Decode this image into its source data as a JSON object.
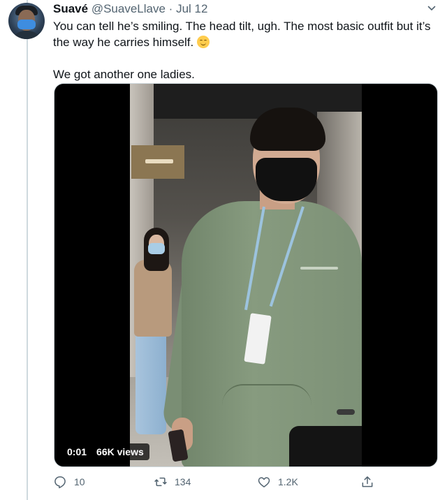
{
  "tweet": {
    "author_name": "Suavé",
    "author_handle": "@SuaveLlave",
    "separator": "·",
    "date": "Jul 12",
    "text_line_1": "You can tell he’s smiling. The head tilt, ugh. The most basic outfit but it’s the way he carries himself.",
    "emoji": "relieved-face-emoji",
    "text_line_2": "We got another one ladies.",
    "avatar": "avatar-masked-man"
  },
  "video": {
    "timestamp": "0:01",
    "views": "66K views"
  },
  "actions": {
    "reply_icon": "reply-icon",
    "reply_count": "10",
    "retweet_icon": "retweet-icon",
    "retweet_count": "134",
    "like_icon": "heart-icon",
    "like_count": "1.2K",
    "share_icon": "share-icon"
  },
  "colors": {
    "text": "#0f1419",
    "muted": "#536471",
    "divider": "#cfd9de",
    "hoodie": "#879b7f"
  }
}
